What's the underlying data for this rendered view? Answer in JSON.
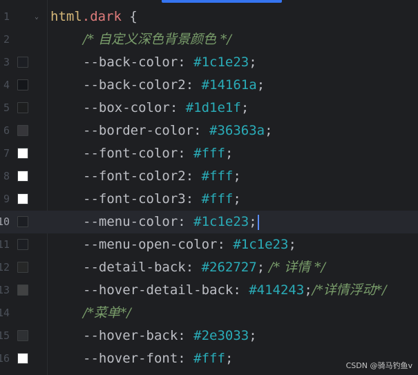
{
  "editor": {
    "accent_color": "#3574f0",
    "background_color": "#1e1f22",
    "selector": {
      "tag": "html",
      "dot": ".",
      "cls": "dark",
      "brace": " {"
    },
    "lines": [
      {
        "num": "1",
        "kind": "selector"
      },
      {
        "num": "2",
        "kind": "comment",
        "text": "/* 自定义深色背景颜色 */"
      },
      {
        "num": "3",
        "kind": "decl",
        "prop": "--back-color",
        "value": "#1c1e23",
        "swatch": "#1c1e23"
      },
      {
        "num": "4",
        "kind": "decl",
        "prop": "--back-color2",
        "value": "#14161a",
        "swatch": "#14161a"
      },
      {
        "num": "5",
        "kind": "decl",
        "prop": "--box-color",
        "value": "#1d1e1f",
        "swatch": "#1d1e1f"
      },
      {
        "num": "6",
        "kind": "decl",
        "prop": "--border-color",
        "value": "#36363a",
        "swatch": "#36363a"
      },
      {
        "num": "7",
        "kind": "decl",
        "prop": "--font-color",
        "value": "#fff",
        "swatch": "#ffffff"
      },
      {
        "num": "8",
        "kind": "decl",
        "prop": "--font-color2",
        "value": "#fff",
        "swatch": "#ffffff"
      },
      {
        "num": "9",
        "kind": "decl",
        "prop": "--font-color3",
        "value": "#fff",
        "swatch": "#ffffff"
      },
      {
        "num": "10",
        "kind": "decl",
        "prop": "--menu-color",
        "value": "#1c1e23",
        "swatch": "#1c1e23",
        "current": true
      },
      {
        "num": "11",
        "kind": "decl",
        "prop": "--menu-open-color",
        "value": "#1c1e23",
        "swatch": "#1c1e23"
      },
      {
        "num": "12",
        "kind": "decl",
        "prop": "--detail-back",
        "value": "#262727",
        "swatch": "#262727",
        "comment": " /* 详情 */"
      },
      {
        "num": "13",
        "kind": "decl",
        "prop": "--hover-detail-back",
        "value": "#414243",
        "swatch": "#414243",
        "comment": "/*详情浮动*/",
        "nospace": true
      },
      {
        "num": "14",
        "kind": "comment",
        "text": "/*菜单*/"
      },
      {
        "num": "15",
        "kind": "decl",
        "prop": "--hover-back",
        "value": "#2e3033",
        "swatch": "#2e3033"
      },
      {
        "num": "16",
        "kind": "decl",
        "prop": "--hover-font",
        "value": "#fff",
        "swatch": "#ffffff"
      }
    ]
  },
  "watermark": "CSDN @骑马钓鱼v"
}
